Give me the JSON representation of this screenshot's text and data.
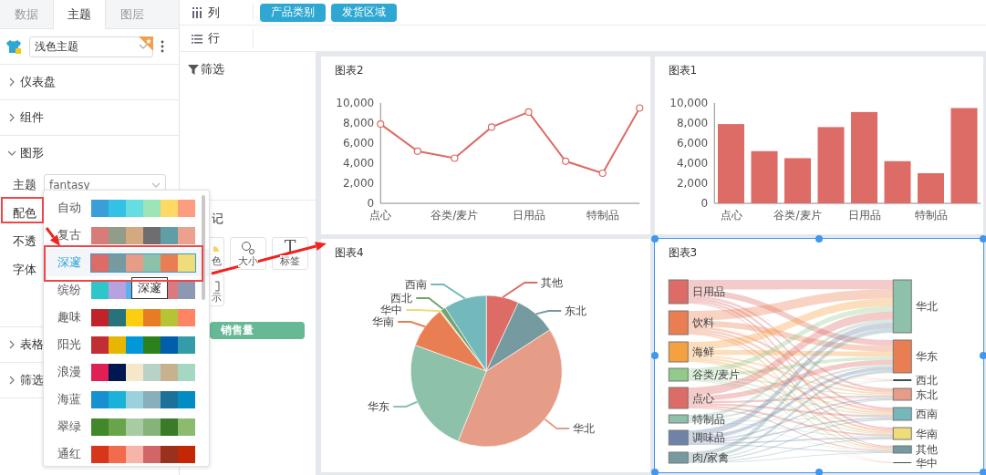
{
  "left_panel": {
    "tabs": [
      {
        "label": "数据",
        "selected": false
      },
      {
        "label": "主题",
        "selected": true
      },
      {
        "label": "图层",
        "selected": false
      }
    ],
    "theme_select": {
      "value": "浅色主题"
    },
    "sections": [
      {
        "label": "仪表盘",
        "expanded": false
      },
      {
        "label": "组件",
        "expanded": false
      },
      {
        "label": "图形",
        "expanded": true,
        "fields": [
          {
            "label": "主题",
            "kind": "select",
            "value": "fantasy"
          },
          {
            "label": "配色",
            "kind": "plain"
          },
          {
            "label": "不透",
            "kind": "plain"
          },
          {
            "label": "字体",
            "kind": "plain"
          }
        ]
      },
      {
        "label": "表格",
        "expanded": false
      },
      {
        "label": "筛选",
        "expanded": false
      }
    ]
  },
  "shelf": {
    "columns": {
      "label": "列",
      "pills": [
        "产品类别",
        "发货区域"
      ]
    },
    "rows": {
      "label": "行"
    }
  },
  "filter_panel": {
    "label": "筛选"
  },
  "marks_panel": {
    "heading": "记",
    "buttons": [
      {
        "label": "色",
        "kind": "color"
      },
      {
        "label": "大小",
        "kind": "size"
      },
      {
        "label": "标签",
        "kind": "text",
        "glyph": "T"
      },
      {
        "label": "示",
        "kind": "detail"
      }
    ],
    "measure": "销售量"
  },
  "palette_dropdown": {
    "tooltip": "深邃",
    "items": [
      {
        "name": "自动",
        "selected": false,
        "swatches": [
          {
            "color": "#3a9fd8"
          },
          {
            "color": "#33c1e6"
          },
          {
            "color": "#66dde0"
          },
          {
            "color": "#9de4b6"
          },
          {
            "color": "#fdd965"
          },
          {
            "color": "#fd9d7f"
          }
        ]
      },
      {
        "name": "复古",
        "selected": false,
        "swatches": [
          {
            "color": "#d77d79"
          },
          {
            "color": "#919c89"
          },
          {
            "color": "#d4a980"
          },
          {
            "color": "#6e6e70"
          },
          {
            "color": "#5f9ea6"
          },
          {
            "color": "#eca08e"
          }
        ]
      },
      {
        "name": "深邃",
        "selected": true,
        "swatches": [
          {
            "color": "#dd6b66"
          },
          {
            "color": "#759aa0"
          },
          {
            "color": "#e69d87"
          },
          {
            "color": "#8dc1a9"
          },
          {
            "color": "#ea7e53"
          },
          {
            "color": "#eedd78"
          }
        ]
      },
      {
        "name": "缤纷",
        "selected": false,
        "swatches": [
          {
            "color": "#2ec7c9"
          },
          {
            "color": "#b6a2de"
          },
          {
            "color": "#5ab1ef"
          },
          {
            "kind": "covered"
          },
          {
            "color": "#d87a80"
          },
          {
            "color": "#8d98b3"
          }
        ]
      },
      {
        "name": "趣味",
        "selected": false,
        "swatches": [
          {
            "color": "#c1232b"
          },
          {
            "color": "#27727b"
          },
          {
            "color": "#fcce10"
          },
          {
            "color": "#e87c25"
          },
          {
            "color": "#b5c334"
          },
          {
            "color": "#fe8463"
          }
        ]
      },
      {
        "name": "阳光",
        "selected": false,
        "swatches": [
          {
            "color": "#c12e34"
          },
          {
            "color": "#e6b600"
          },
          {
            "color": "#0098d9"
          },
          {
            "color": "#2b821d"
          },
          {
            "color": "#005eaa"
          },
          {
            "color": "#339ca8"
          }
        ]
      },
      {
        "name": "浪漫",
        "selected": false,
        "swatches": [
          {
            "color": "#e01f54"
          },
          {
            "color": "#001852"
          },
          {
            "color": "#f5e8c8"
          },
          {
            "color": "#b8d2c7"
          },
          {
            "color": "#c6b38e"
          },
          {
            "color": "#a4d8c2"
          }
        ]
      },
      {
        "name": "海蓝",
        "selected": false,
        "swatches": [
          {
            "color": "#1790cf"
          },
          {
            "color": "#1bb2d8"
          },
          {
            "color": "#99d2dd"
          },
          {
            "color": "#88b0bb"
          },
          {
            "color": "#1c7099"
          },
          {
            "color": "#038cc4"
          }
        ]
      },
      {
        "name": "翠绿",
        "selected": false,
        "swatches": [
          {
            "color": "#408829"
          },
          {
            "color": "#68a54a"
          },
          {
            "color": "#a9cba2"
          },
          {
            "color": "#86b379"
          },
          {
            "color": "#397b29"
          },
          {
            "color": "#8abb6f"
          }
        ]
      },
      {
        "name": "通红",
        "selected": false,
        "swatches": [
          {
            "color": "#d8361b"
          },
          {
            "color": "#f16b4c"
          },
          {
            "color": "#f7b4a9"
          },
          {
            "color": "#d26666"
          },
          {
            "color": "#99311c"
          },
          {
            "color": "#c42703"
          }
        ]
      }
    ]
  },
  "charts": [
    {
      "title": "图表2",
      "kind": "cartesian",
      "selected": false,
      "chart_data": {
        "type": "line",
        "categories": [
          "点心",
          null,
          "谷类/麦片",
          null,
          "日用品",
          null,
          "特制品",
          null
        ],
        "ylim": [
          0,
          10000
        ],
        "yticks": [
          {
            "value": 0,
            "label": "0"
          },
          {
            "value": 2000,
            "label": "2,000"
          },
          {
            "value": 4000,
            "label": "4,000"
          },
          {
            "value": 6000,
            "label": "6,000"
          },
          {
            "value": 8000,
            "label": "8,000"
          },
          {
            "value": 10000,
            "label": "10,000"
          }
        ],
        "series": [
          {
            "color": "#dd6b66",
            "marker": true,
            "values": [
              7900,
              5200,
              4500,
              7600,
              9100,
              4200,
              3000,
              9500
            ]
          }
        ]
      }
    },
    {
      "title": "图表1",
      "kind": "cartesian",
      "selected": false,
      "chart_data": {
        "type": "bar",
        "categories": [
          "点心",
          null,
          "谷类/麦片",
          null,
          "日用品",
          null,
          "特制品",
          null
        ],
        "ylim": [
          0,
          10000
        ],
        "yticks": [
          {
            "value": 0,
            "label": "0"
          },
          {
            "value": 2000,
            "label": "2,000"
          },
          {
            "value": 4000,
            "label": "4,000"
          },
          {
            "value": 6000,
            "label": "6,000"
          },
          {
            "value": 8000,
            "label": "8,000"
          },
          {
            "value": 10000,
            "label": "10,000"
          }
        ],
        "series": [
          {
            "color": "#dd6b66",
            "values": [
              7900,
              5200,
              4500,
              7600,
              9100,
              4200,
              3000,
              9500
            ]
          }
        ]
      }
    },
    {
      "title": "图表4",
      "kind": "pie",
      "selected": false,
      "slices": [
        {
          "label": "其他",
          "color": "#dd6b66"
        },
        {
          "label": "东北",
          "color": "#759aa0"
        },
        {
          "label": "华北",
          "color": "#e69d87"
        },
        {
          "label": "华东",
          "color": "#8dc1a9"
        },
        {
          "label": "华南",
          "color": "#ea7e53"
        },
        {
          "label": "华中",
          "color": "#eedd78"
        },
        {
          "label": "西北",
          "color": "#73a373"
        },
        {
          "label": "西南",
          "color": "#73b9bc"
        }
      ]
    },
    {
      "title": "图表3",
      "kind": "sankey",
      "selected": true,
      "sources": [
        {
          "label": "日用品",
          "color": "#dd6b66"
        },
        {
          "label": "饮料",
          "color": "#ea7e53"
        },
        {
          "label": "海鲜",
          "color": "#f5a142"
        },
        {
          "label": "谷类/麦片",
          "color": "#91ca8c"
        },
        {
          "label": "点心",
          "color": "#dd6b66"
        },
        {
          "label": "特制品",
          "color": "#8dc1a9"
        },
        {
          "label": "调味品",
          "color": "#6e83a8"
        },
        {
          "label": "肉/家禽",
          "color": "#759aa0"
        }
      ],
      "targets": [
        {
          "label": "华北",
          "color": "#8dc1a9"
        },
        {
          "label": "华东",
          "color": "#ea7e53"
        },
        {
          "label": "西北",
          "color": "#3d4f4c"
        },
        {
          "label": "东北",
          "color": "#e69d87"
        },
        {
          "label": "西南",
          "color": "#73b9bc"
        },
        {
          "label": "华南",
          "color": "#eedd78"
        },
        {
          "label": "其他",
          "color": "#759aa0"
        },
        {
          "label": "华中",
          "color": "#3d4f4c"
        }
      ]
    }
  ]
}
